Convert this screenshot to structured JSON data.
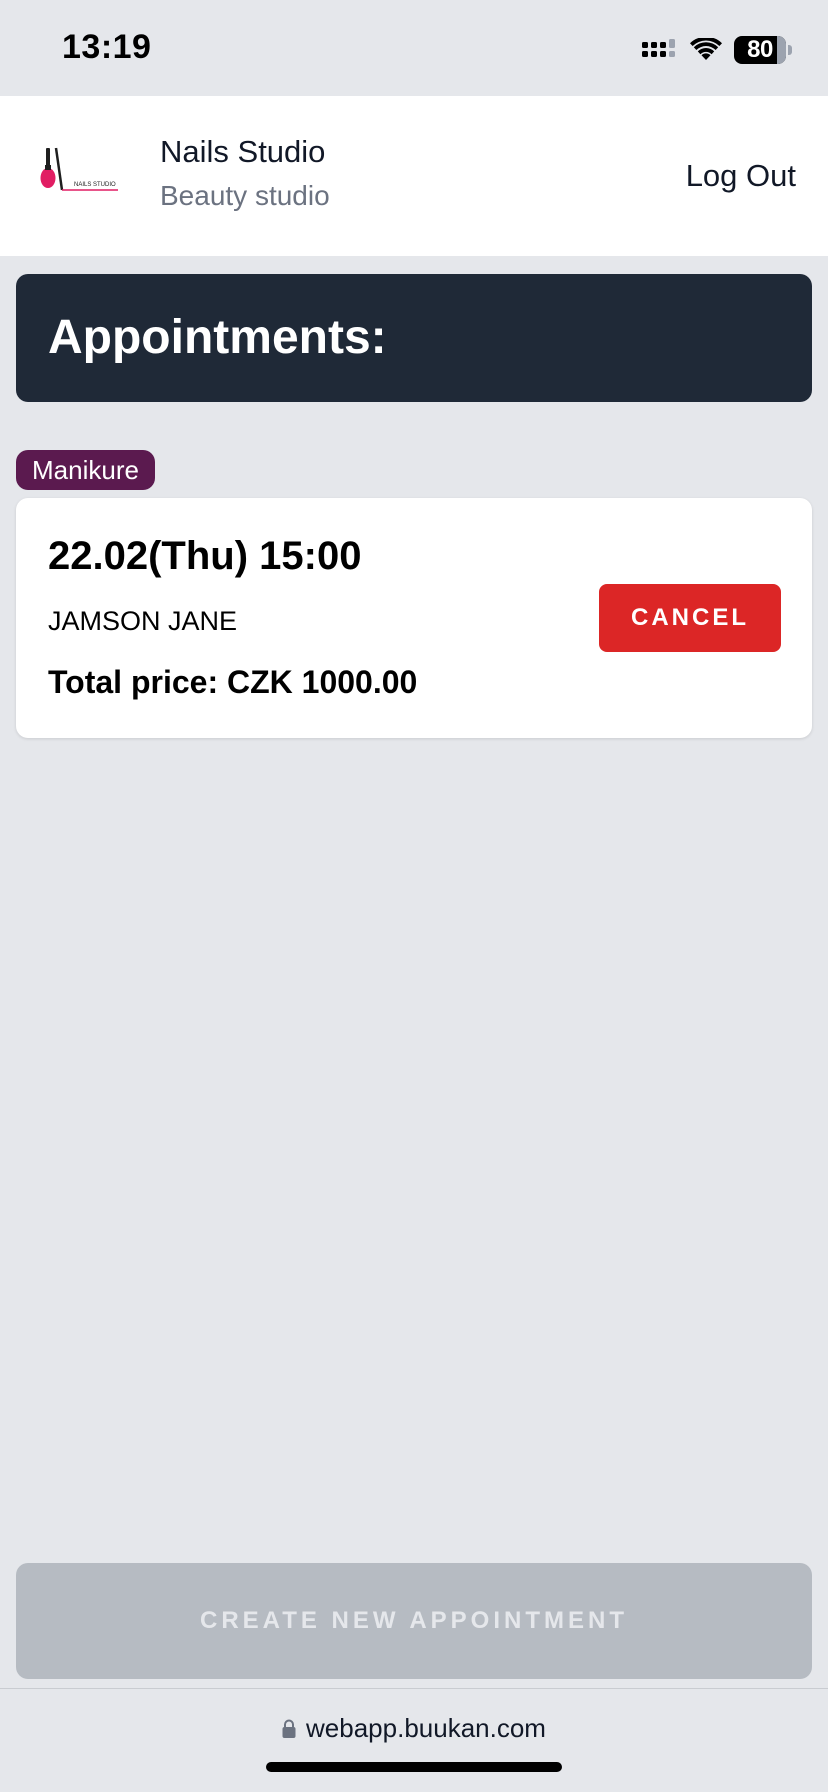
{
  "status_bar": {
    "time": "13:19",
    "battery": "80",
    "icons": [
      "cellular-signal-icon",
      "wifi-icon",
      "battery-icon"
    ]
  },
  "header": {
    "logo_text": "NAILS STUDIO",
    "business_name": "Nails Studio",
    "business_type": "Beauty studio",
    "logout_label": "Log Out"
  },
  "banner": {
    "title": "Appointments:"
  },
  "appointments": [
    {
      "service": "Manikure",
      "datetime": "22.02(Thu) 15:00",
      "client": "JAMSON JANE",
      "price": "Total price: CZK 1000.00",
      "cancel_label": "CANCEL"
    }
  ],
  "footer": {
    "create_label": "CREATE NEW APPOINTMENT"
  },
  "browser": {
    "url": "webapp.buukan.com"
  },
  "colors": {
    "page_bg": "#e5e7eb",
    "banner_bg": "#1f2937",
    "service_tag": "#5b1a4f",
    "cancel": "#dc2626",
    "create_disabled": "#b6bbc2",
    "logo_accent": "#e11d63"
  }
}
